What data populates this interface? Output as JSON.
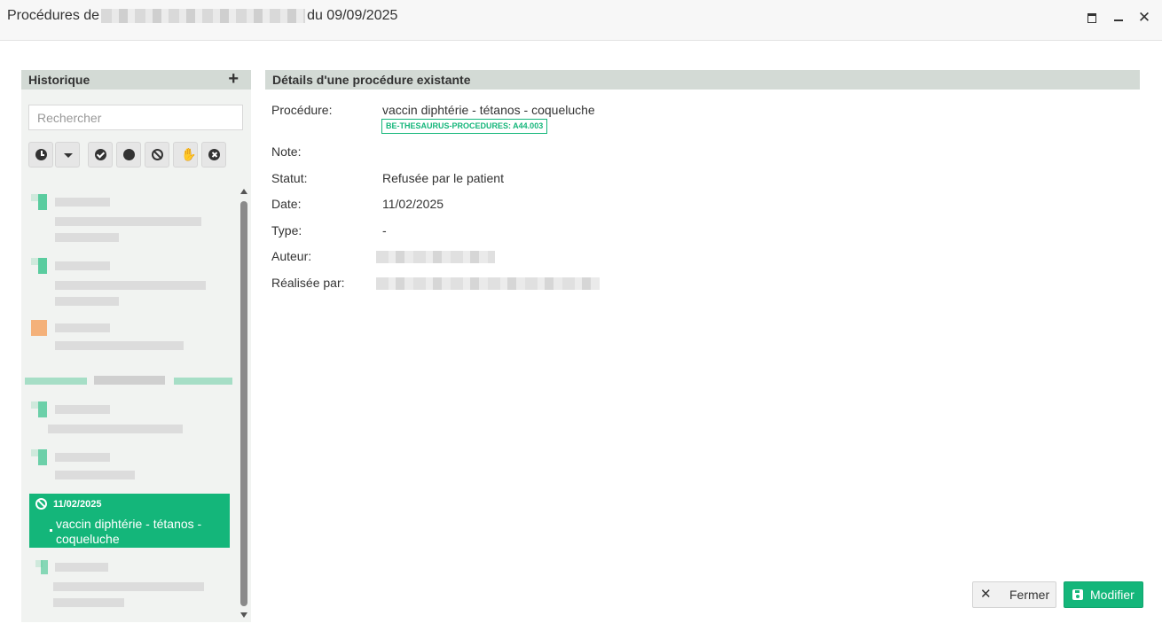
{
  "window": {
    "title_prefix": "Procédures de",
    "title_suffix": "du 09/09/2025",
    "close_glyph": "✕"
  },
  "sidebar": {
    "title": "Historique",
    "add_glyph": "+",
    "search_placeholder": "Rechercher",
    "filters": [
      "clock-icon",
      "chevron-down-icon",
      "check-circle-icon",
      "circle-icon",
      "ban-icon",
      "hand-icon",
      "x-circle-icon"
    ],
    "hand_glyph": "✋",
    "selected_item": {
      "date": "11/02/2025",
      "name": "vaccin diphtérie - tétanos - coqueluche",
      "status_icon": "ban-icon"
    }
  },
  "details": {
    "header": "Détails d'une procédure existante",
    "labels": {
      "procedure": "Procédure:",
      "note": "Note:",
      "statut": "Statut:",
      "date": "Date:",
      "type": "Type:",
      "auteur": "Auteur:",
      "realisee": "Réalisée par:"
    },
    "values": {
      "procedure": "vaccin diphtérie - tétanos - coqueluche",
      "code": "BE-THESAURUS-PROCEDURES: A44.003",
      "statut": "Refusée par le patient",
      "date": "11/02/2025",
      "type": "-"
    }
  },
  "actions": {
    "close_label": "Fermer",
    "close_glyph": "✕",
    "save_label": "Modifier"
  },
  "colors": {
    "accent": "#14b67a",
    "header_bg": "#d3dad5"
  }
}
